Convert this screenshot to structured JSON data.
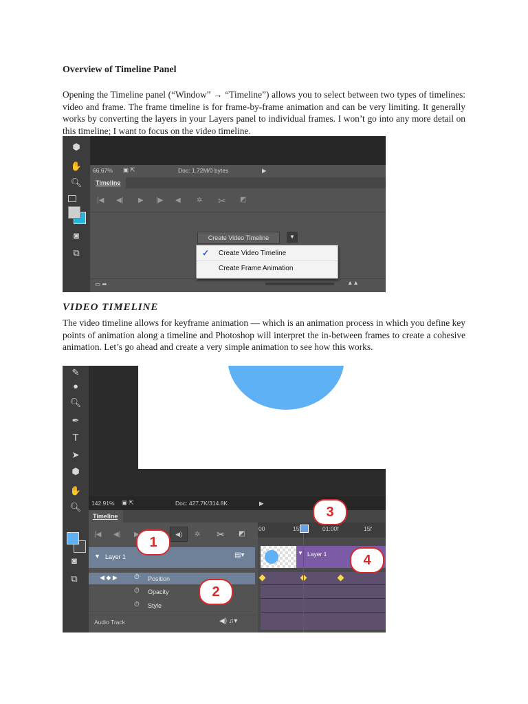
{
  "article": {
    "heading": "Overview of Timeline Panel",
    "intro": "Opening the Timeline panel (“Window” → “Timeline”) allows you to select between two types of timelines: video and frame. The frame timeline is for frame-by-frame animation and can be very limiting. It generally works by converting the layers in your Layers panel to individual frames. I won’t go into any more detail on this timeline; I want to focus on the video timeline.",
    "subheading": "VIDEO TIMELINE",
    "body": "The video timeline allows for keyframe animation — which is an animation process in which you define key points of animation along a timeline and Photoshop will interpret the in-between frames to create a cohesive animation. Let’s go ahead and create a very simple animation to see how this works."
  },
  "screenshot1": {
    "zoom": "66.67%",
    "doc": "Doc: 1.72M/0 bytes",
    "tab": "Timeline",
    "button": "Create Video Timeline",
    "menu_items": [
      "Create Video Timeline",
      "Create Frame Animation"
    ],
    "checked": "✓"
  },
  "screenshot2": {
    "zoom": "142.91%",
    "doc": "Doc: 427.7K/314.8K",
    "tab": "Timeline",
    "ruler": [
      "00",
      "15f",
      "01:00f",
      "15f"
    ],
    "layer": "Layer 1",
    "clip": "Layer 1",
    "rows": [
      "Position",
      "Opacity",
      "Style"
    ],
    "audio": "Audio Track",
    "callouts": [
      "1",
      "2",
      "3",
      "4"
    ],
    "colors": {
      "circle": "#5fb1f5",
      "clip": "#7b5aa6",
      "track": "#5e4f6f",
      "playhead": "#d62a2a"
    }
  }
}
